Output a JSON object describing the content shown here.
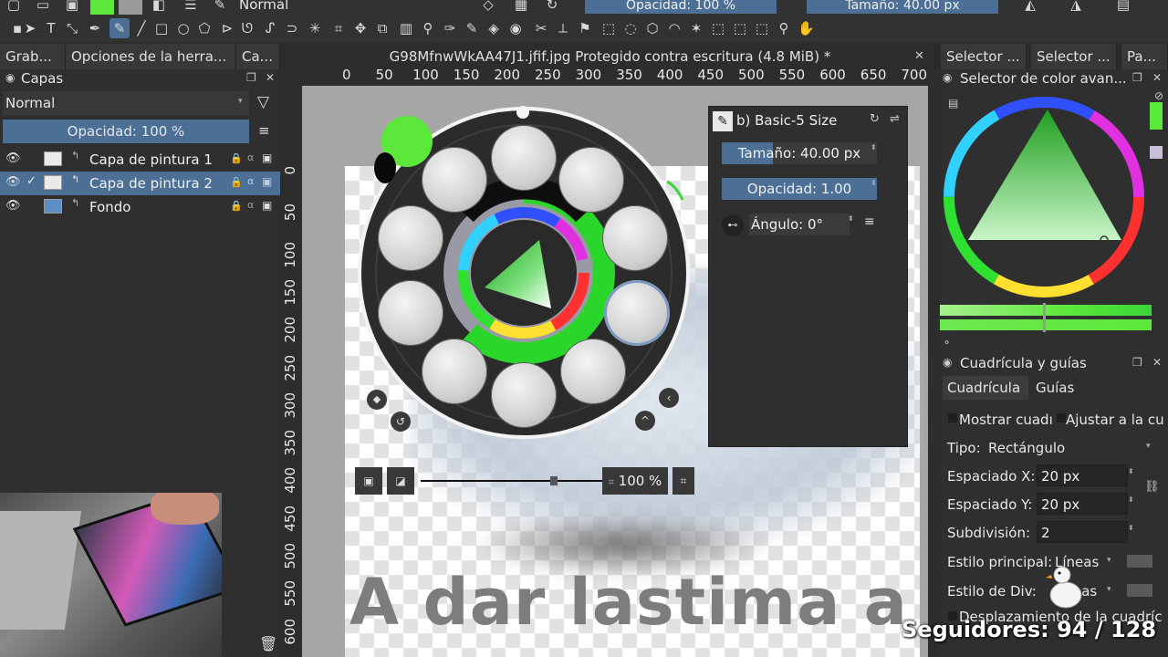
{
  "toolbar": {
    "blend_mode": "Normal",
    "opacity_label": "Opacidad: 100 %",
    "size_label": "Tamaño: 40.00 px",
    "fg_color": "#5ce83a",
    "bg_color": "#9a9a9a"
  },
  "tabs": {
    "left": [
      "Grab...",
      "Opciones de la herra...",
      "Ca..."
    ],
    "document": "G98MfnwWkAA47J1.jfif.jpg Protegido contra escritura (4.8 MiB) *",
    "right": [
      "Selector ...",
      "Selector ...",
      "Pa..."
    ]
  },
  "layers": {
    "title": "Capas",
    "blend_mode": "Normal",
    "opacity_label": "Opacidad:  100 %",
    "items": [
      {
        "name": "Capa de pintura 1",
        "selected": false
      },
      {
        "name": "Capa de pintura 2",
        "selected": true
      },
      {
        "name": "Fondo",
        "selected": false
      }
    ]
  },
  "rulers": {
    "top": [
      "0",
      "50",
      "100",
      "150",
      "200",
      "250",
      "300",
      "350",
      "400",
      "450",
      "500",
      "550",
      "600",
      "650",
      "700"
    ],
    "left": [
      "0",
      "50",
      "100",
      "150",
      "200",
      "250",
      "300",
      "350",
      "400",
      "450",
      "500",
      "550",
      "600"
    ]
  },
  "canvas": {
    "overlay_text": "A dar lastima a"
  },
  "tool_options": {
    "preset": "b) Basic-5 Size",
    "size": "Tamaño: 40.00 px",
    "opacity": "Opacidad: 1.00",
    "angle": "Ángulo: 0°"
  },
  "zoom": {
    "value": "100 %"
  },
  "color_selector": {
    "title": "Selector de color avan..."
  },
  "grid_panel": {
    "title": "Cuadrícula y guías",
    "tabs": [
      "Cuadrícula",
      "Guías"
    ],
    "show_grid": "Mostrar cuadı",
    "snap_grid": "Ajustar a la cu",
    "type_label": "Tipo:",
    "type_value": "Rectángulo",
    "spacing_x_label": "Espaciado X:",
    "spacing_x": "20 px",
    "spacing_y_label": "Espaciado Y:",
    "spacing_y": "20 px",
    "subdivision_label": "Subdivisión:",
    "subdivision": "2",
    "main_style_label": "Estilo principal:",
    "main_style": "Líneas",
    "div_style_label": "Estilo de Div:",
    "div_style": "eas",
    "offset_label": "Desplazamiento de la cuadríc"
  },
  "stream": {
    "followers": "Seguidores: 94 / 128"
  }
}
